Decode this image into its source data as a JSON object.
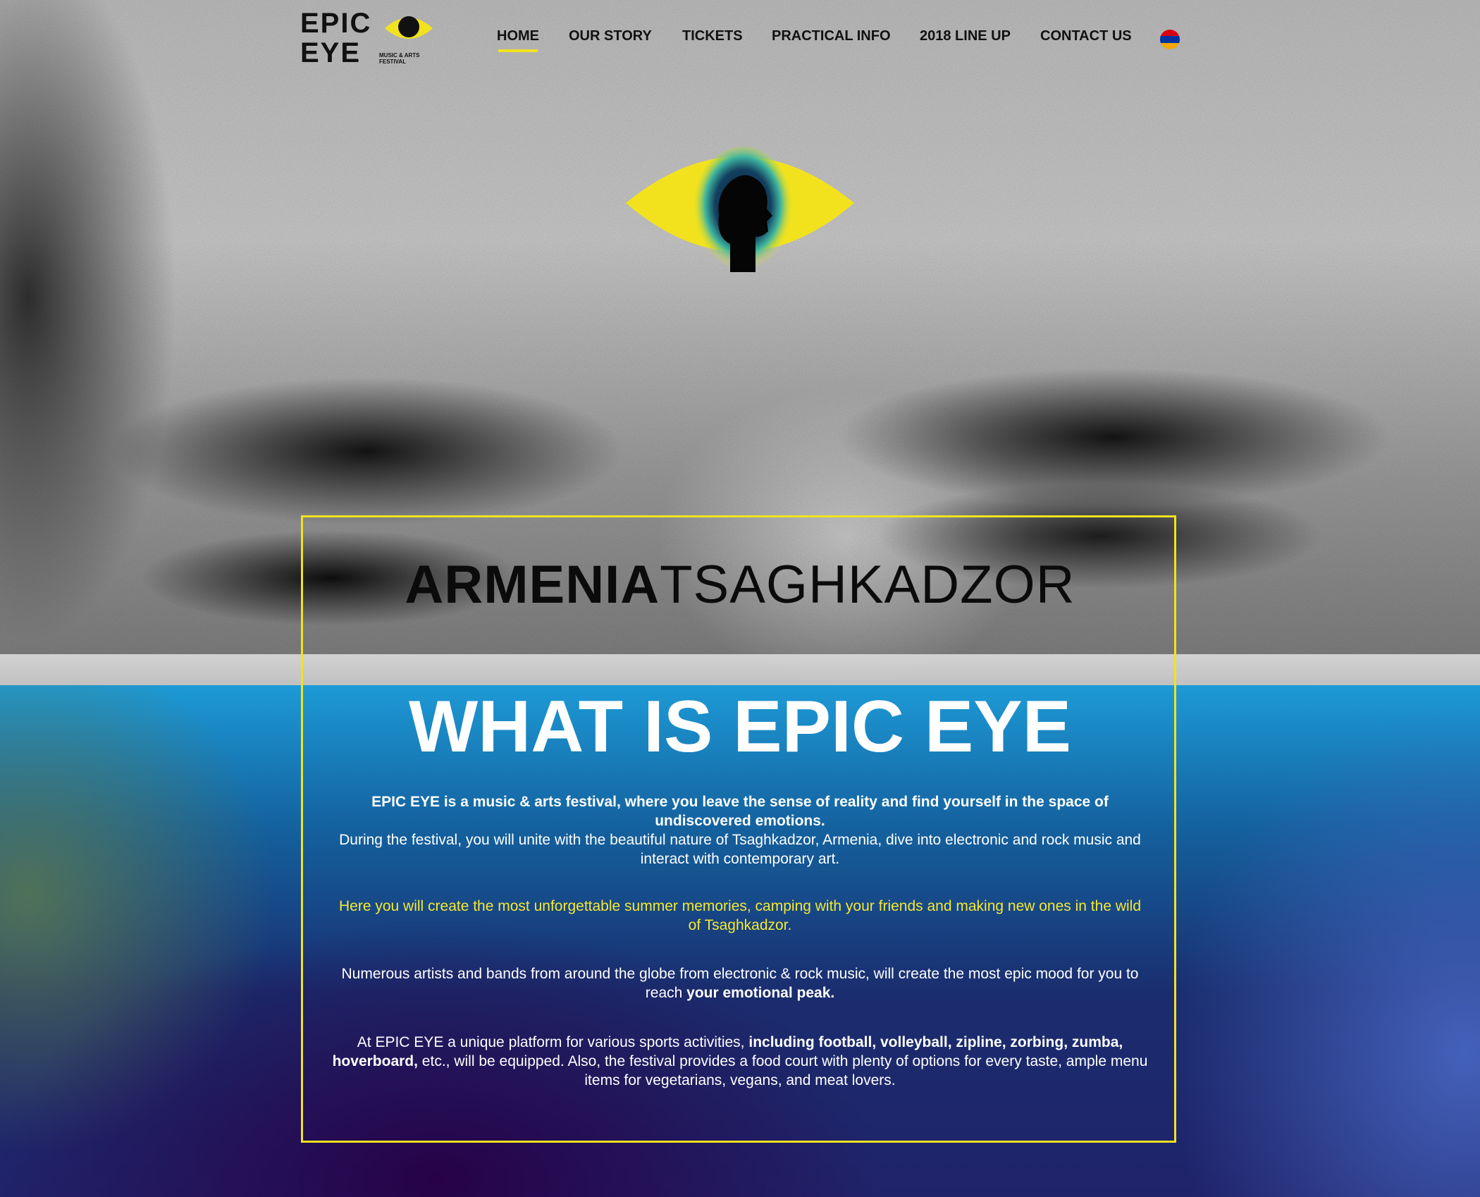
{
  "logo": {
    "line1": "EPIC",
    "line2": "EYE",
    "tagline": "MUSIC & ARTS FESTIVAL"
  },
  "nav": {
    "items": [
      {
        "label": "HOME",
        "active": true
      },
      {
        "label": "OUR STORY",
        "active": false
      },
      {
        "label": "TICKETS",
        "active": false
      },
      {
        "label": "PRACTICAL INFO",
        "active": false
      },
      {
        "label": "2018 LINE UP",
        "active": false
      },
      {
        "label": "CONTACT US",
        "active": false
      }
    ],
    "language_flag": "armenia-flag-icon"
  },
  "colors": {
    "accent": "#f2e21e",
    "yellow_text": "#f5e832",
    "flag_red": "#d90012",
    "flag_blue": "#0033a0",
    "flag_orange": "#f2a800"
  },
  "hero": {
    "location_a": "ARMENIA",
    "location_b": "TSAGHKADZOR"
  },
  "about": {
    "heading": "WHAT IS EPIC EYE",
    "p1_bold": "EPIC EYE is a music & arts festival, where you leave the sense of reality and find yourself in the space of undiscovered emotions.",
    "p1_rest": "During the festival, you will unite with the beautiful nature of Tsaghkadzor, Armenia, dive into electronic and rock music and interact with contemporary art.",
    "p2": "Here you will create the most unforgettable summer memories, camping with your friends and making new ones in the wild of Tsaghkadzor.",
    "p3_a": "Numerous artists and bands from around the globe from electronic & rock music, will create the most epic mood for you to reach ",
    "p3_bold": "your emotional peak.",
    "p4_a": "At EPIC EYE a unique platform for various sports activities, ",
    "p4_bold": "including football, volleyball, zipline, zorbing, zumba, hoverboard,",
    "p4_b": " etc., will be equipped. Also, the festival provides a food court with plenty of options for every taste, ample menu items for vegetarians, vegans, and meat lovers."
  }
}
